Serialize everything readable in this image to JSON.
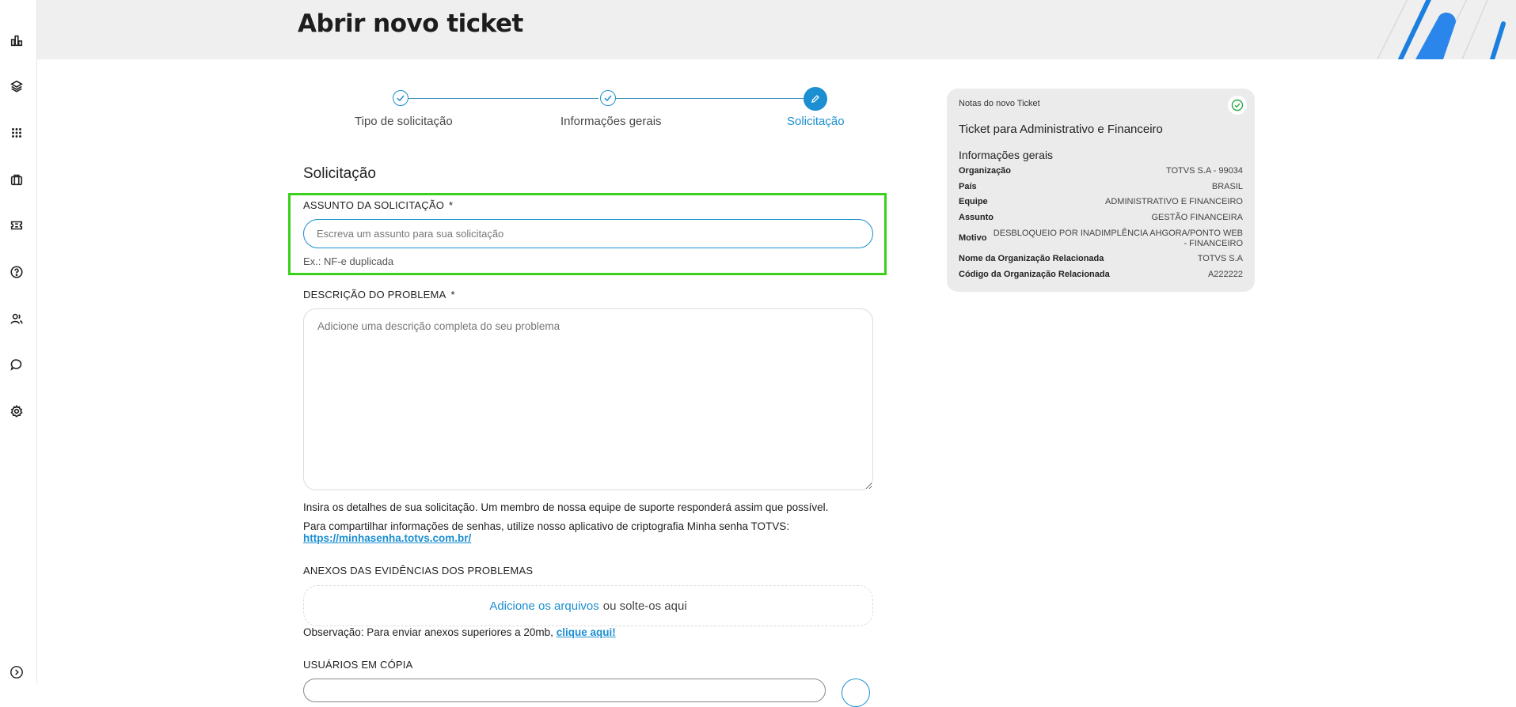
{
  "header": {
    "title": "Abrir novo ticket"
  },
  "sidebar": {
    "icons": [
      "chart-icon",
      "layers-icon",
      "apps-grid-icon",
      "briefcase-icon",
      "ticket-icon",
      "help-icon",
      "users-icon",
      "chat-icon",
      "settings-icon"
    ],
    "expand_icon": "chevron-right-icon"
  },
  "stepper": {
    "steps": [
      {
        "label": "Tipo de solicitação",
        "state": "done"
      },
      {
        "label": "Informações gerais",
        "state": "done"
      },
      {
        "label": "Solicitação",
        "state": "active"
      }
    ]
  },
  "form": {
    "section_title": "Solicitação",
    "subject": {
      "label": "ASSUNTO DA SOLICITAÇÃO",
      "required_mark": "*",
      "placeholder": "Escreva um assunto para sua solicitação",
      "value": "",
      "hint": "Ex.: NF-e duplicada"
    },
    "description": {
      "label": "DESCRIÇÃO DO PROBLEMA",
      "required_mark": "*",
      "placeholder": "Adicione uma descrição completa do seu problema",
      "value": ""
    },
    "info_line_1": "Insira os detalhes de sua solicitação. Um membro de nossa equipe de suporte responderá assim que possível.",
    "info_line_2": "Para compartilhar informações de senhas, utilize nosso aplicativo de criptografia Minha senha TOTVS:",
    "password_link": "https://minhasenha.totvs.com.br/",
    "attachments": {
      "label": "ANEXOS DAS EVIDÊNCIAS DOS PROBLEMAS",
      "add_link": "Adicione os arquivos",
      "drop_text": "ou solte-os aqui",
      "note": "Observação: Para enviar anexos superiores a 20mb,",
      "note_link": "clique aqui!"
    },
    "cc": {
      "label": "USUÁRIOS EM CÓPIA"
    }
  },
  "notes": {
    "header": "Notas do novo Ticket",
    "title": "Ticket para Administrativo e Financeiro",
    "section": "Informações gerais",
    "rows": [
      {
        "key": "Organização",
        "value": "TOTVS S.A - 99034"
      },
      {
        "key": "País",
        "value": "BRASIL"
      },
      {
        "key": "Equipe",
        "value": "ADMINISTRATIVO E FINANCEIRO"
      },
      {
        "key": "Assunto",
        "value": "GESTÃO FINANCEIRA"
      },
      {
        "key": "Motivo",
        "value": "DESBLOQUEIO POR INADIMPLÊNCIA AHGORA/PONTO WEB - FINANCEIRO"
      },
      {
        "key": "Nome da Organização Relacionada",
        "value": "TOTVS S.A"
      },
      {
        "key": "Código da Organização Relacionada",
        "value": "A222222"
      }
    ]
  },
  "colors": {
    "accent": "#1b8fd1",
    "highlight": "#39d11b",
    "header_bg": "#efefef",
    "card_bg": "#ebebeb"
  }
}
